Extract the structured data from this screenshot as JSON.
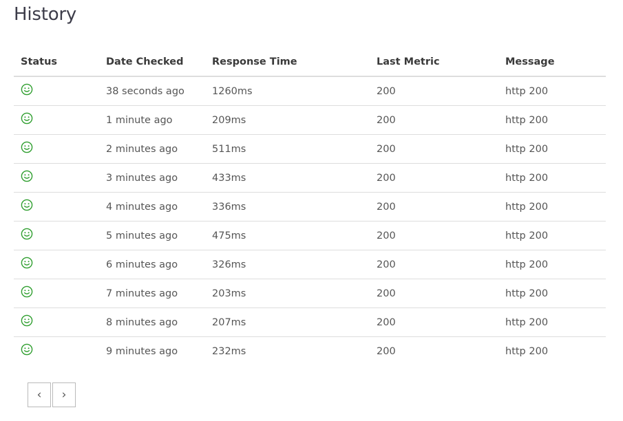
{
  "page": {
    "title": "History"
  },
  "table": {
    "headers": {
      "status": "Status",
      "date_checked": "Date Checked",
      "response_time": "Response Time",
      "last_metric": "Last Metric",
      "message": "Message"
    },
    "status_icon": "smiley-face-icon",
    "status_color": "#2e9e2e",
    "rows": [
      {
        "status": "up",
        "date_checked": "38 seconds ago",
        "response_time": "1260ms",
        "last_metric": "200",
        "message": "http 200"
      },
      {
        "status": "up",
        "date_checked": "1 minute ago",
        "response_time": "209ms",
        "last_metric": "200",
        "message": "http 200"
      },
      {
        "status": "up",
        "date_checked": "2 minutes ago",
        "response_time": "511ms",
        "last_metric": "200",
        "message": "http 200"
      },
      {
        "status": "up",
        "date_checked": "3 minutes ago",
        "response_time": "433ms",
        "last_metric": "200",
        "message": "http 200"
      },
      {
        "status": "up",
        "date_checked": "4 minutes ago",
        "response_time": "336ms",
        "last_metric": "200",
        "message": "http 200"
      },
      {
        "status": "up",
        "date_checked": "5 minutes ago",
        "response_time": "475ms",
        "last_metric": "200",
        "message": "http 200"
      },
      {
        "status": "up",
        "date_checked": "6 minutes ago",
        "response_time": "326ms",
        "last_metric": "200",
        "message": "http 200"
      },
      {
        "status": "up",
        "date_checked": "7 minutes ago",
        "response_time": "203ms",
        "last_metric": "200",
        "message": "http 200"
      },
      {
        "status": "up",
        "date_checked": "8 minutes ago",
        "response_time": "207ms",
        "last_metric": "200",
        "message": "http 200"
      },
      {
        "status": "up",
        "date_checked": "9 minutes ago",
        "response_time": "232ms",
        "last_metric": "200",
        "message": "http 200"
      }
    ]
  },
  "pagination": {
    "prev_label": "‹",
    "next_label": "›"
  }
}
